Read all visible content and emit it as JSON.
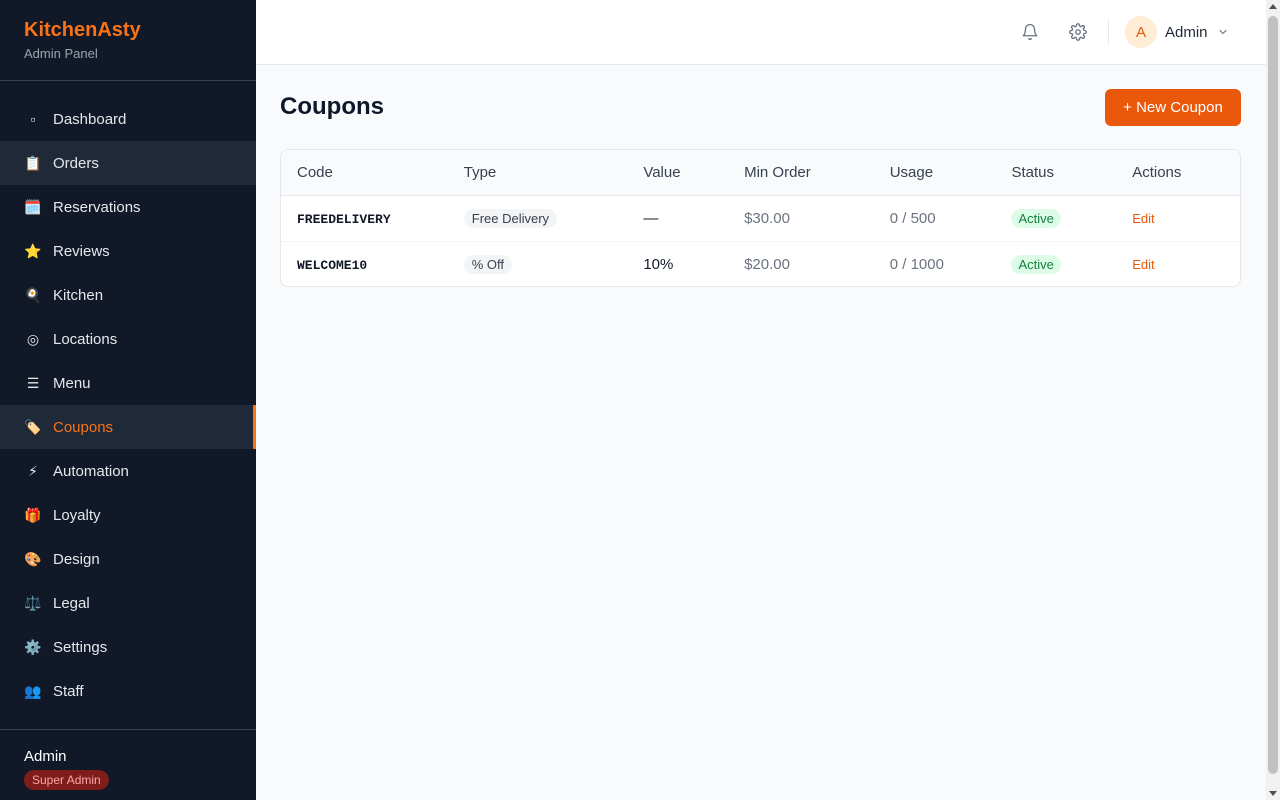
{
  "brand": {
    "name": "KitchenAsty",
    "subtitle": "Admin Panel"
  },
  "sidebar": {
    "items": [
      {
        "label": "Dashboard",
        "icon": "▫",
        "icon_name": "dashboard-icon"
      },
      {
        "label": "Orders",
        "icon": "📋",
        "icon_name": "clipboard-icon"
      },
      {
        "label": "Reservations",
        "icon": "🗓️",
        "icon_name": "calendar-icon"
      },
      {
        "label": "Reviews",
        "icon": "⭐",
        "icon_name": "star-icon"
      },
      {
        "label": "Kitchen",
        "icon": "🍳",
        "icon_name": "kitchen-icon"
      },
      {
        "label": "Locations",
        "icon": "◎",
        "icon_name": "location-icon"
      },
      {
        "label": "Menu",
        "icon": "☰",
        "icon_name": "menu-icon"
      },
      {
        "label": "Coupons",
        "icon": "🏷️",
        "icon_name": "tag-icon"
      },
      {
        "label": "Automation",
        "icon": "⚡",
        "icon_name": "lightning-icon"
      },
      {
        "label": "Loyalty",
        "icon": "🎁",
        "icon_name": "gift-icon"
      },
      {
        "label": "Design",
        "icon": "🎨",
        "icon_name": "palette-icon"
      },
      {
        "label": "Legal",
        "icon": "⚖️",
        "icon_name": "scales-icon"
      },
      {
        "label": "Settings",
        "icon": "⚙️",
        "icon_name": "gear-icon"
      },
      {
        "label": "Staff",
        "icon": "👥",
        "icon_name": "people-icon"
      }
    ],
    "active": "Coupons",
    "hovered": "Orders"
  },
  "footer": {
    "name": "Admin",
    "role": "Super Admin"
  },
  "topbar": {
    "user_initial": "A",
    "user_name": "Admin"
  },
  "page": {
    "title": "Coupons",
    "new_button": "+ New Coupon"
  },
  "table": {
    "headers": [
      "Code",
      "Type",
      "Value",
      "Min Order",
      "Usage",
      "Status",
      "Actions"
    ],
    "rows": [
      {
        "code": "FREEDELIVERY",
        "type": "Free Delivery",
        "value": "—",
        "min_order": "$30.00",
        "usage": "0 / 500",
        "status": "Active",
        "action": "Edit"
      },
      {
        "code": "WELCOME10",
        "type": "% Off",
        "value": "10%",
        "min_order": "$20.00",
        "usage": "0 / 1000",
        "status": "Active",
        "action": "Edit"
      }
    ]
  },
  "colors": {
    "accent": "#ea580c",
    "brand": "#f97316",
    "sidebar_bg": "#111827",
    "active_status": "#15803d"
  }
}
